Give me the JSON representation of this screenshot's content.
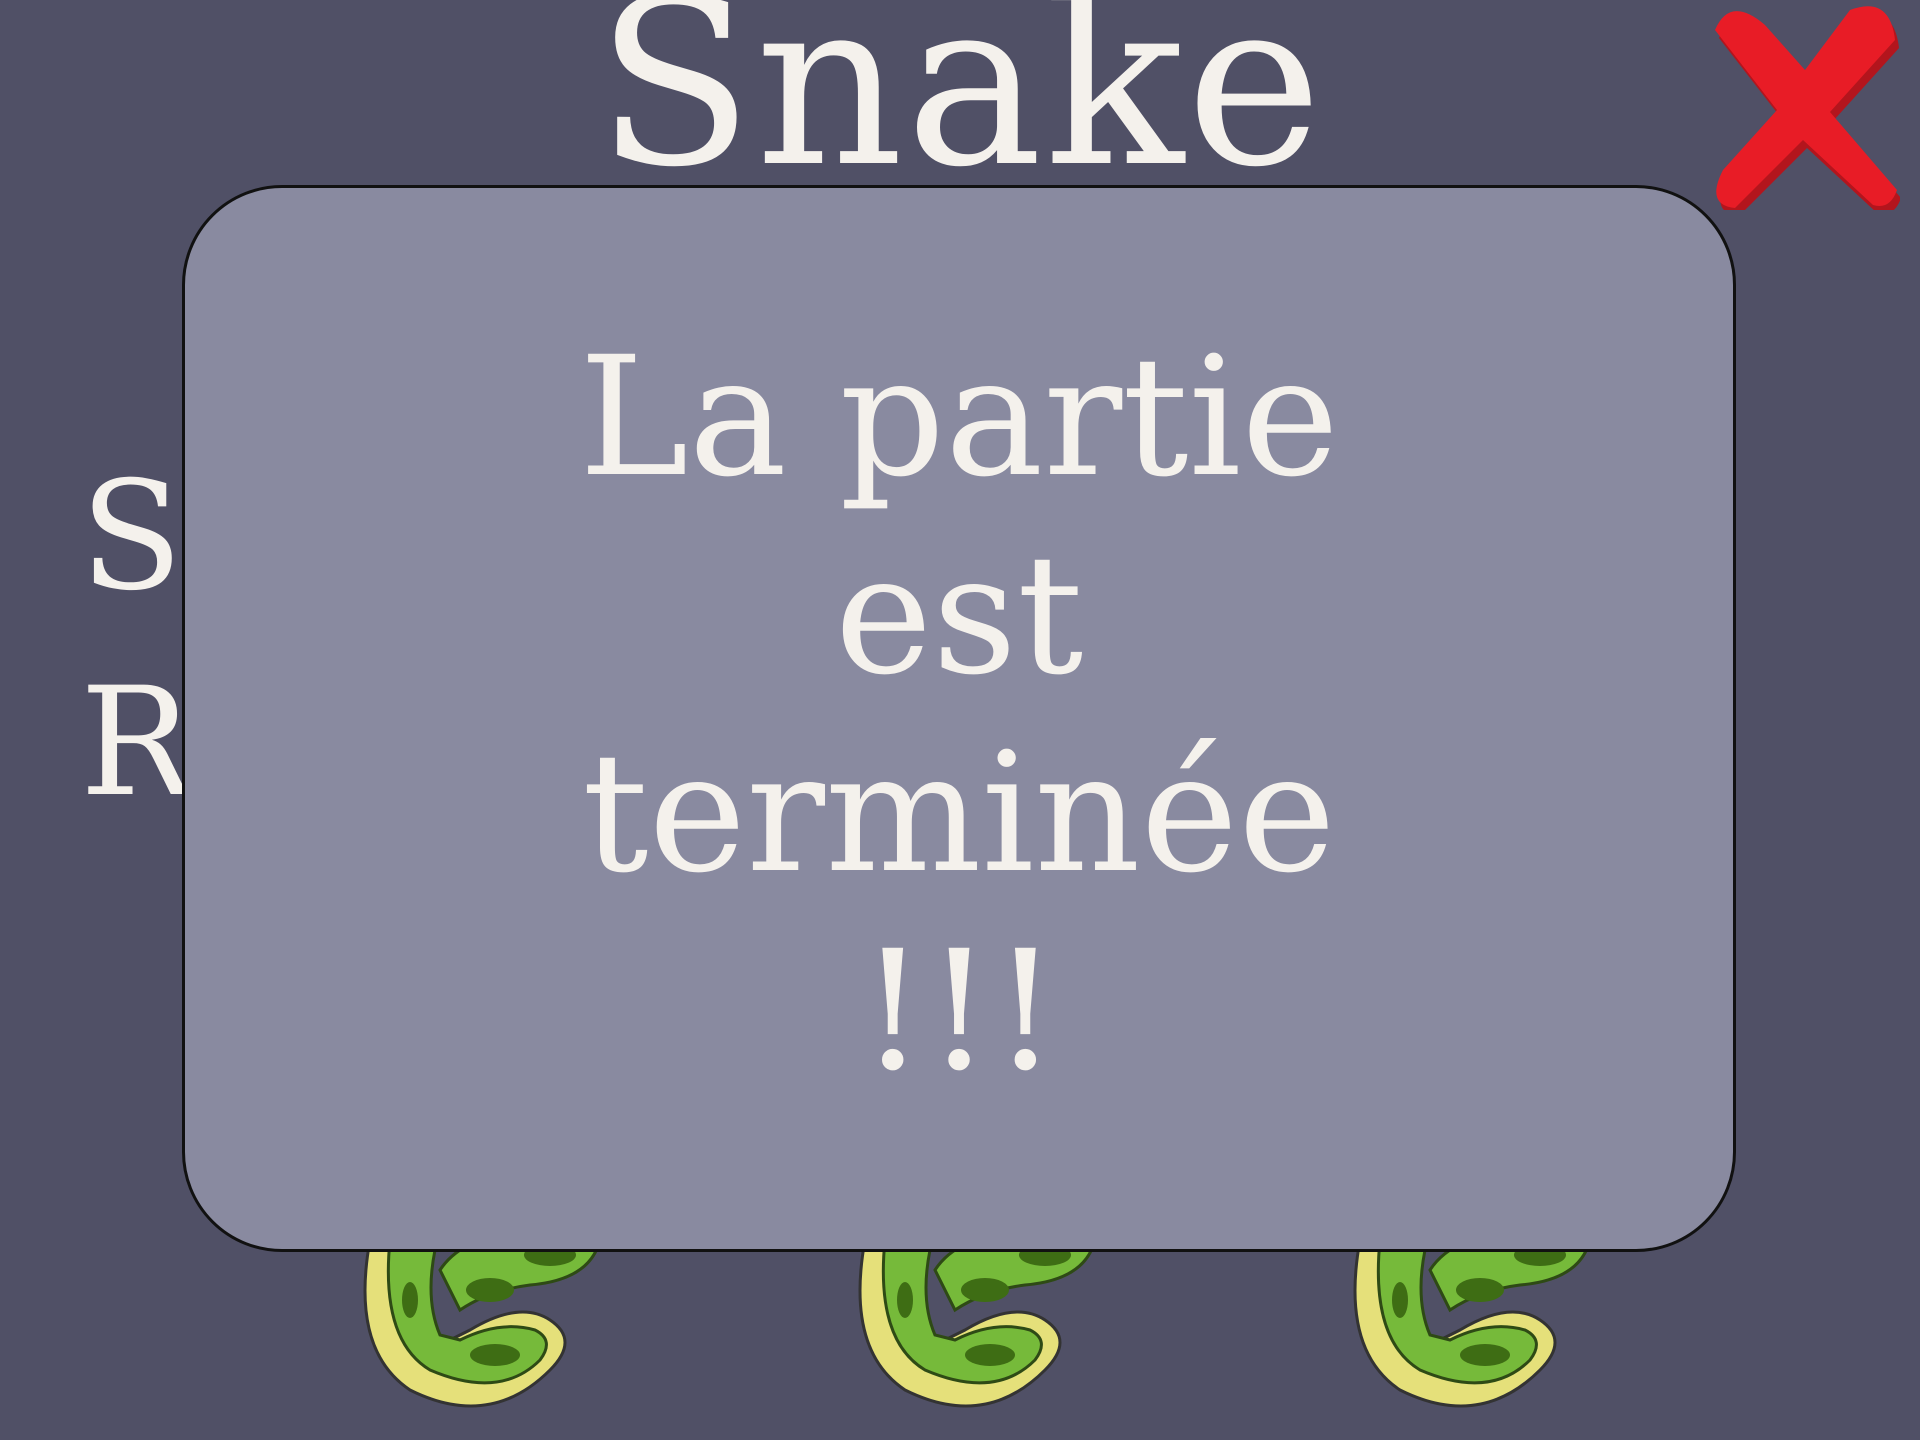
{
  "game": {
    "title": "Snake",
    "background_color": "#505066",
    "text_color": "#f4f1ec",
    "close_icon": "red-x-icon",
    "close_color": "#e81c26",
    "background_labels": [
      "Sc",
      "R"
    ],
    "snake_icons": [
      "snake-icon",
      "snake-icon",
      "snake-icon"
    ]
  },
  "modal": {
    "message": "La partie est terminée !!!",
    "background_color": "#898aa0"
  }
}
